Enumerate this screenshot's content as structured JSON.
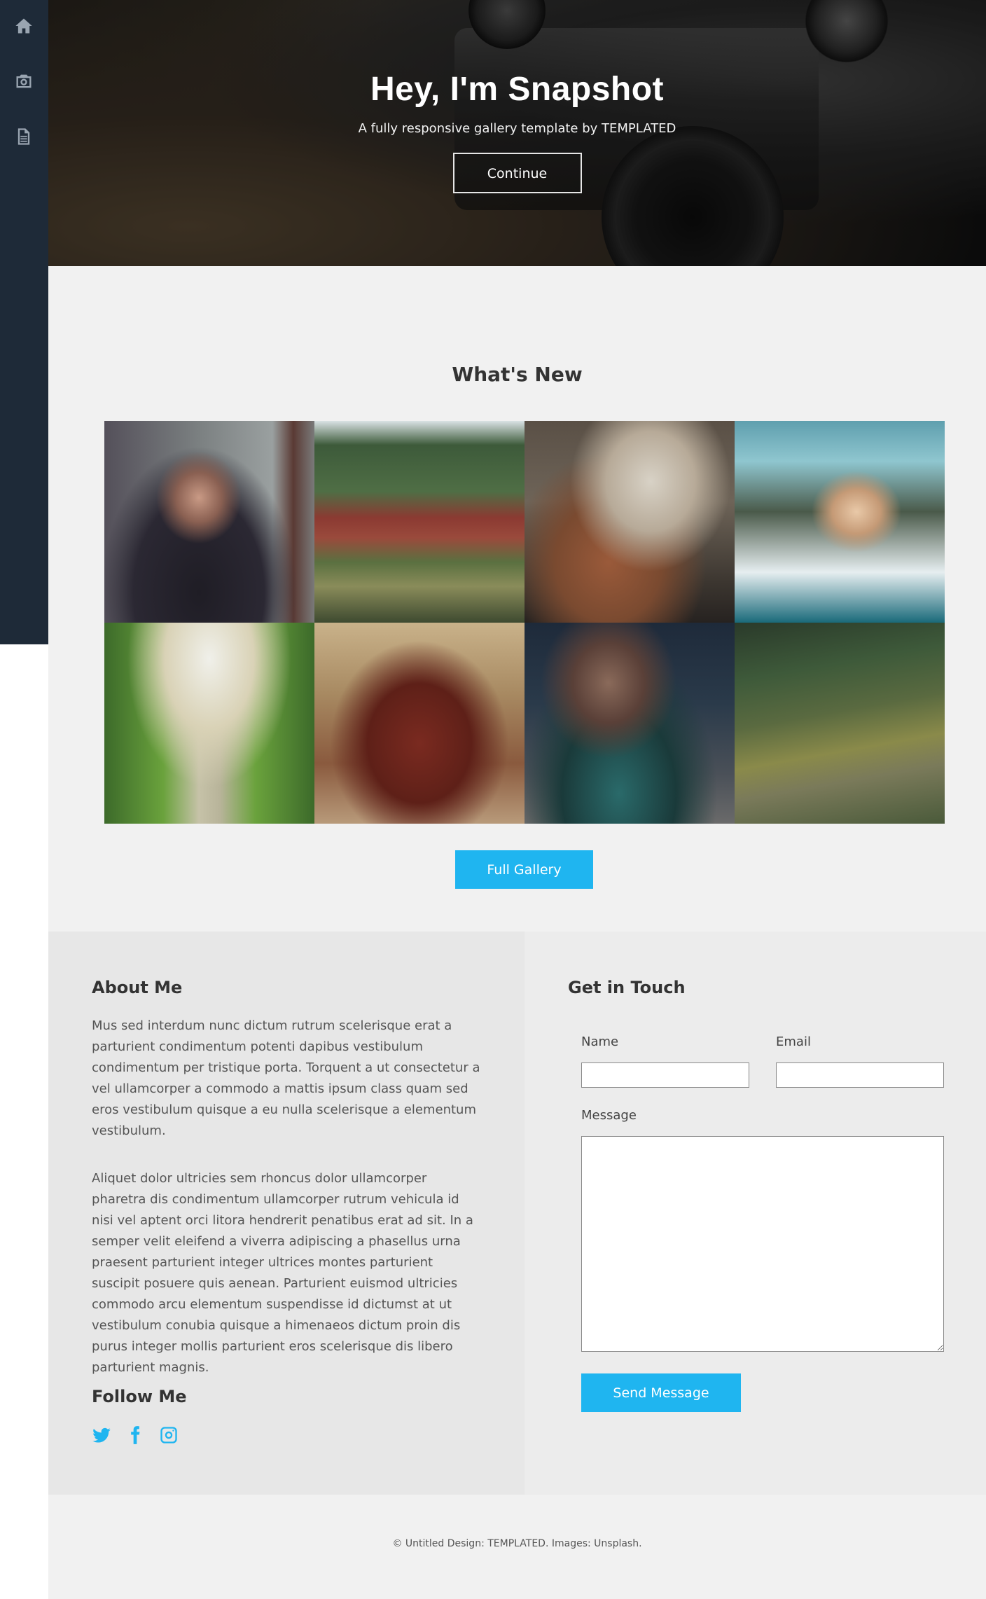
{
  "sidebar": {
    "items": [
      {
        "icon": "home-icon"
      },
      {
        "icon": "camera-icon"
      },
      {
        "icon": "document-icon"
      }
    ]
  },
  "banner": {
    "title": "Hey, I'm Snapshot",
    "subtitle": "A fully responsive gallery template by TEMPLATED",
    "button": "Continue"
  },
  "whats_new": {
    "title": "What's New",
    "gallery_button": "Full Gallery"
  },
  "about": {
    "title": "About Me",
    "paragraph1": "Mus sed interdum nunc dictum rutrum scelerisque erat a parturient condimentum potenti dapibus vestibulum condimentum per tristique porta. Torquent a ut consectetur a vel ullamcorper a commodo a mattis ipsum class quam sed eros vestibulum quisque a eu nulla scelerisque a elementum vestibulum.",
    "paragraph2": "Aliquet dolor ultricies sem rhoncus dolor ullamcorper pharetra dis condimentum ullamcorper rutrum vehicula id nisi vel aptent orci litora hendrerit penatibus erat ad sit. In a semper velit eleifend a viverra adipiscing a phasellus urna praesent parturient integer ultrices montes parturient suscipit posuere quis aenean. Parturient euismod ultricies commodo arcu elementum suspendisse id dictumst at ut vestibulum conubia quisque a himenaeos dictum proin dis purus integer mollis parturient eros scelerisque dis libero parturient magnis.",
    "follow_title": "Follow Me",
    "socials": [
      "twitter-icon",
      "facebook-icon",
      "instagram-icon"
    ]
  },
  "contact": {
    "title": "Get in Touch",
    "name_label": "Name",
    "name_value": "",
    "email_label": "Email",
    "email_value": "",
    "message_label": "Message",
    "message_value": "",
    "send_button": "Send Message"
  },
  "footer": {
    "text": "© Untitled Design: TEMPLATED. Images: Unsplash."
  },
  "colors": {
    "sidebar_bg": "#1e2a38",
    "accent": "#1fb5f0",
    "section_bg": "#f1f1f1"
  }
}
